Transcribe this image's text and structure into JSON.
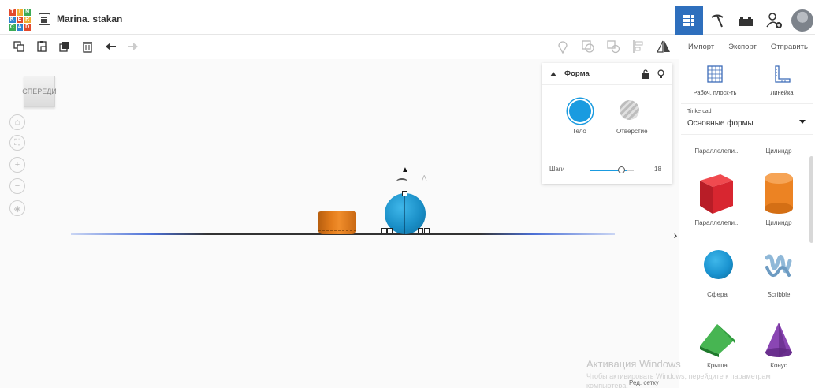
{
  "header": {
    "logo_letters": [
      "T",
      "I",
      "N",
      "K",
      "E",
      "R",
      "C",
      "A",
      "D"
    ],
    "logo_colors": [
      "#e2492c",
      "#f0ad32",
      "#3cab56",
      "#2f83cf",
      "#e2492c",
      "#f0ad32",
      "#3cab56",
      "#2f83cf",
      "#e2492c"
    ],
    "design_title": "Marina. stakan",
    "right_icons": [
      "grid-view-icon",
      "tinker-icon",
      "bricks-icon",
      "add-user-icon"
    ],
    "active_color": "#2e6fbd"
  },
  "toolbar": {
    "left_icons": [
      "copy-icon",
      "paste-icon",
      "duplicate-icon",
      "delete-icon",
      "undo-icon",
      "redo-icon"
    ],
    "right_icons": [
      "note-icon",
      "group-icon",
      "ungroup-icon",
      "align-icon",
      "mirror-icon"
    ]
  },
  "panel_buttons": {
    "import": "Импорт",
    "export": "Экспорт",
    "send": "Отправить"
  },
  "workspace": {
    "view_cube_label": "СПЕРЕДИ",
    "nav_icons": [
      "home-icon",
      "fit-icon",
      "zoom-in-icon",
      "zoom-out-icon",
      "orthographic-icon"
    ],
    "shapes": [
      {
        "name": "cylinder-shape",
        "color": "#e47d1c"
      },
      {
        "name": "sphere-shape",
        "color": "#1a8fc7"
      }
    ]
  },
  "inspector": {
    "title": "Форма",
    "solid_label": "Тело",
    "hole_label": "Отверстие",
    "steps_label": "Шаги",
    "steps_value": "18",
    "solid_color": "#1a9be0"
  },
  "side_panel": {
    "workplane_label": "Рабоч. плоск-ть",
    "ruler_label": "Линейка",
    "library_category": "Tinkercad",
    "library_name": "Основные формы",
    "shapes_partial": [
      "Параллелепи...",
      "Цилиндр"
    ],
    "shapes": [
      {
        "label": "Параллелепи...",
        "icon": "box-icon",
        "color": "#d82630"
      },
      {
        "label": "Цилиндр",
        "icon": "cylinder-icon",
        "color": "#ec8323"
      },
      {
        "label": "Сфера",
        "icon": "sphere-icon",
        "color": "#1a93d0"
      },
      {
        "label": "Scribble",
        "icon": "scribble-icon",
        "color": "#8fb8d8"
      },
      {
        "label": "Крыша",
        "icon": "roof-icon",
        "color": "#2e9a3c"
      },
      {
        "label": "Конус",
        "icon": "cone-icon",
        "color": "#7a3a9e"
      }
    ]
  },
  "watermark": {
    "line1": "Активация Windows",
    "line2": "Чтобы активировать Windows, перейдите к параметрам",
    "line3": "компьютера.",
    "edit_grid": "Ред. сетку"
  }
}
